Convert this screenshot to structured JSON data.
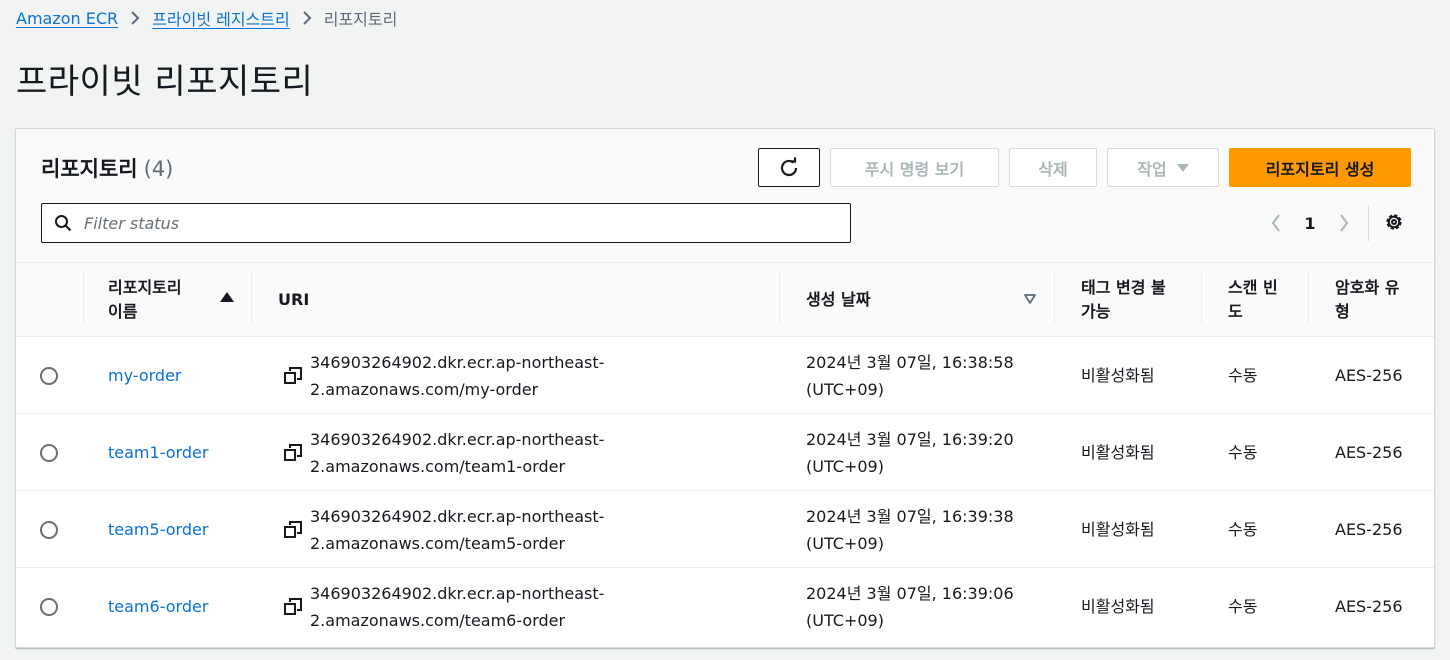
{
  "breadcrumb": {
    "items": [
      "Amazon ECR",
      "프라이빗 레지스트리"
    ],
    "current": "리포지토리"
  },
  "page_title": "프라이빗 리포지토리",
  "container": {
    "title": "리포지토리",
    "count": "(4)"
  },
  "toolbar": {
    "refresh_icon": "refresh-icon",
    "push_label": "푸시 명령 보기",
    "delete_label": "삭제",
    "actions_label": "작업",
    "create_label": "리포지토리 생성"
  },
  "filter": {
    "placeholder": "Filter status",
    "value": ""
  },
  "pagination": {
    "current_page": "1"
  },
  "table": {
    "columns": {
      "name_line1": "리포지토리",
      "name_line2": "이름",
      "uri": "URI",
      "created": "생성 날짜",
      "immutability_line1": "태그 변경 불",
      "immutability_line2": "가능",
      "scan_line1": "스캔 빈",
      "scan_line2": "도",
      "encryption_line1": "암호화 유",
      "encryption_line2": "형"
    },
    "rows": [
      {
        "name": "my-order",
        "uri_line1": "346903264902.dkr.ecr.ap-northeast-",
        "uri_line2": "2.amazonaws.com/my-order",
        "created_line1": "2024년 3월 07일, 16:38:58",
        "created_line2": "(UTC+09)",
        "immutability": "비활성화됨",
        "scan": "수동",
        "encryption": "AES-256"
      },
      {
        "name": "team1-order",
        "uri_line1": "346903264902.dkr.ecr.ap-northeast-",
        "uri_line2": "2.amazonaws.com/team1-order",
        "created_line1": "2024년 3월 07일, 16:39:20",
        "created_line2": "(UTC+09)",
        "immutability": "비활성화됨",
        "scan": "수동",
        "encryption": "AES-256"
      },
      {
        "name": "team5-order",
        "uri_line1": "346903264902.dkr.ecr.ap-northeast-",
        "uri_line2": "2.amazonaws.com/team5-order",
        "created_line1": "2024년 3월 07일, 16:39:38",
        "created_line2": "(UTC+09)",
        "immutability": "비활성화됨",
        "scan": "수동",
        "encryption": "AES-256"
      },
      {
        "name": "team6-order",
        "uri_line1": "346903264902.dkr.ecr.ap-northeast-",
        "uri_line2": "2.amazonaws.com/team6-order",
        "created_line1": "2024년 3월 07일, 16:39:06",
        "created_line2": "(UTC+09)",
        "immutability": "비활성화됨",
        "scan": "수동",
        "encryption": "AES-256"
      }
    ]
  },
  "colors": {
    "link": "#0972d3",
    "primary_button": "#ff9900",
    "text": "#16191f",
    "muted": "#5f6b7a"
  }
}
